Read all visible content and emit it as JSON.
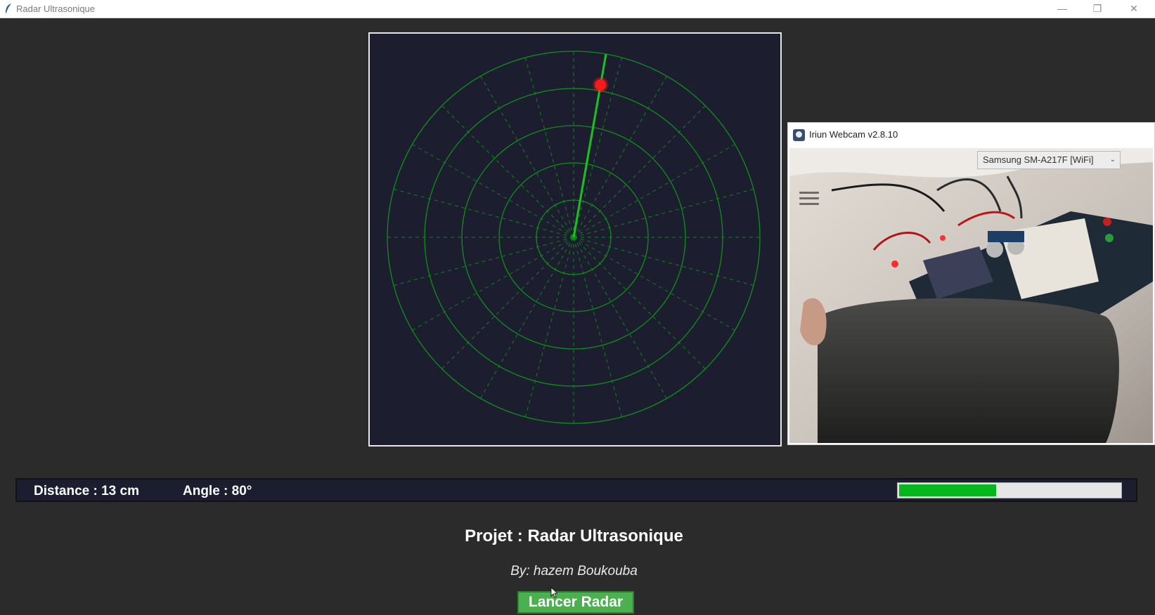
{
  "window": {
    "title": "Radar Ultrasonique",
    "controls": {
      "minimize": "—",
      "maximize": "❐",
      "close": "✕"
    }
  },
  "radar": {
    "sweep_angle_deg": 80,
    "target_distance_cm": 13,
    "colors": {
      "background": "#1c1e30",
      "grid": "#0f8f17",
      "sweep": "#19c221",
      "target": "#ff1a1a"
    }
  },
  "webcam": {
    "title": "Iriun Webcam v2.8.10",
    "device": "Samsung SM-A217F [WiFi]"
  },
  "status": {
    "distance_text": "Distance : 13 cm",
    "angle_text": "Angle : 80°",
    "progress_fraction": 0.44
  },
  "footer": {
    "project_title": "Projet : Radar Ultrasonique",
    "author": "By: hazem Boukouba",
    "launch_button": "Lancer Radar"
  }
}
